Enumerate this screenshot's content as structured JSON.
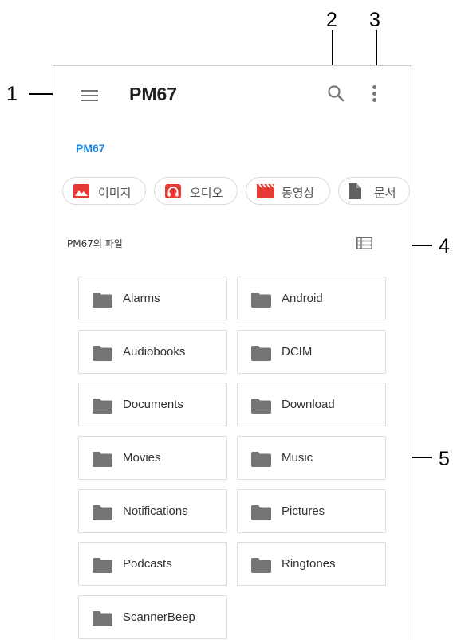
{
  "callouts": [
    "1",
    "2",
    "3",
    "4",
    "5"
  ],
  "app": {
    "title": "PM67",
    "breadcrumb": "PM67"
  },
  "icons": {
    "menu": "hamburger-menu-icon",
    "search": "search-icon",
    "more": "more-vert-icon",
    "list_view": "list-view-icon",
    "folder": "folder-icon"
  },
  "colors": {
    "accent": "#1e88e5",
    "category_icon": "#e53935",
    "folder_icon": "#757575",
    "doc_icon": "#616161"
  },
  "categories": [
    {
      "label": "이미지",
      "icon": "image-icon"
    },
    {
      "label": "오디오",
      "icon": "audio-icon"
    },
    {
      "label": "동영상",
      "icon": "video-icon"
    },
    {
      "label": "문서",
      "icon": "document-icon"
    }
  ],
  "section_label": "PM67의 파일",
  "folders": [
    "Alarms",
    "Android",
    "Audiobooks",
    "DCIM",
    "Documents",
    "Download",
    "Movies",
    "Music",
    "Notifications",
    "Pictures",
    "Podcasts",
    "Ringtones",
    "ScannerBeep"
  ]
}
